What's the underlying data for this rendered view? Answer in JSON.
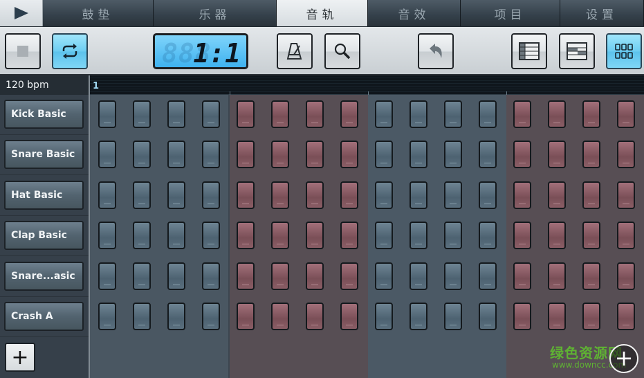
{
  "tabs": [
    {
      "label": "鼓垫",
      "active": false
    },
    {
      "label": "乐器",
      "active": false
    },
    {
      "label": "音轨",
      "active": true
    },
    {
      "label": "音效",
      "active": false
    },
    {
      "label": "项目",
      "active": false
    },
    {
      "label": "设置",
      "active": false
    }
  ],
  "play_button": {
    "icon": "play-icon"
  },
  "toolbar": {
    "stop": {
      "icon": "stop-icon"
    },
    "loop": {
      "icon": "loop-icon",
      "active": true
    },
    "lcd": {
      "ghost": "888",
      "value": "1:1"
    },
    "metronome": {
      "icon": "metronome-icon"
    },
    "zoom": {
      "icon": "magnifier-icon"
    },
    "undo": {
      "icon": "undo-icon"
    },
    "view_list": {
      "icon": "list-view-icon"
    },
    "view_piano": {
      "icon": "piano-roll-view-icon"
    },
    "view_grid": {
      "icon": "grid-view-icon",
      "active": true
    }
  },
  "tempo": "120 bpm",
  "timeline": {
    "bar_label": "1"
  },
  "instruments": [
    {
      "name": "Kick Basic"
    },
    {
      "name": "Snare Basic"
    },
    {
      "name": "Hat Basic"
    },
    {
      "name": "Clap Basic"
    },
    {
      "name": "Snare...asic"
    },
    {
      "name": "Crash A"
    }
  ],
  "add_instrument": "+",
  "steps": {
    "count": 16,
    "group_colors": [
      "blue",
      "red",
      "blue",
      "red"
    ],
    "active": []
  },
  "fab": "+",
  "watermark": {
    "text": "绿色资源网",
    "url": "www.downcc.com"
  }
}
